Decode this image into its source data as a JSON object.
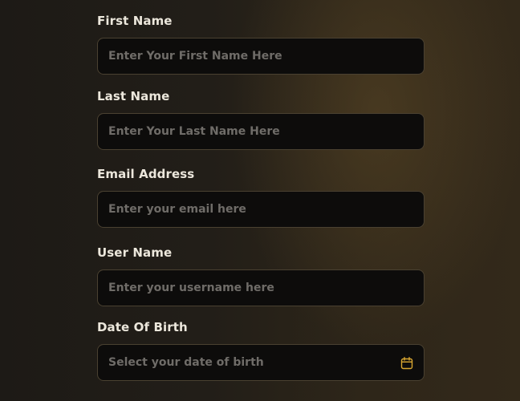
{
  "form": {
    "fields": [
      {
        "label": "First Name",
        "placeholder": "Enter Your First Name Here",
        "value": ""
      },
      {
        "label": "Last Name",
        "placeholder": "Enter Your Last Name Here",
        "value": ""
      },
      {
        "label": "Email Address",
        "placeholder": "Enter your email here",
        "value": ""
      },
      {
        "label": "User Name",
        "placeholder": "Enter your username here",
        "value": ""
      },
      {
        "label": "Date Of Birth",
        "placeholder": "Select your date of birth",
        "value": "",
        "icon": "calendar-icon"
      }
    ]
  },
  "colors": {
    "accent": "#d9a731",
    "label": "#ece7dc",
    "placeholder": "#6f6c68",
    "input_bg": "#0d0c0b",
    "input_border": "#4a4131"
  }
}
